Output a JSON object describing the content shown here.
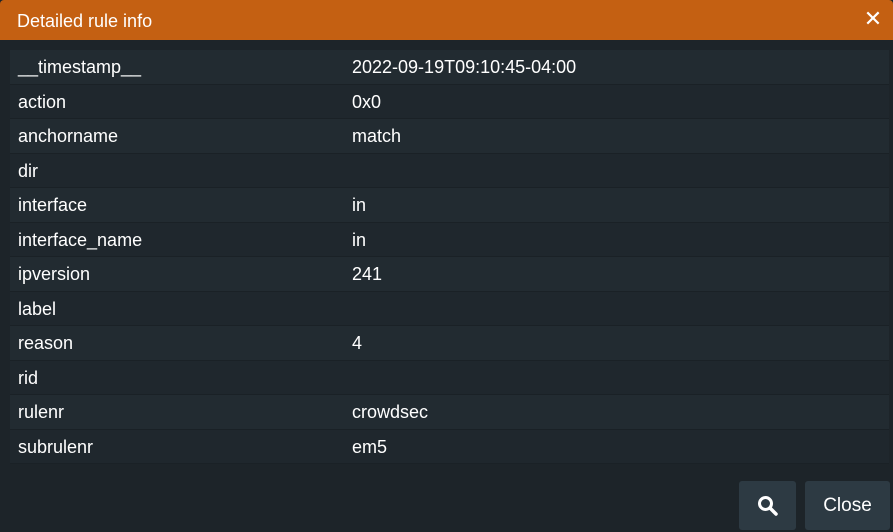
{
  "dialog": {
    "title": "Detailed rule info",
    "close_glyph": "✕"
  },
  "rows": [
    {
      "key": "__timestamp__",
      "value": "2022-09-19T09:10:45-04:00"
    },
    {
      "key": "action",
      "value": "0x0"
    },
    {
      "key": "anchorname",
      "value": "match"
    },
    {
      "key": "dir",
      "value": ""
    },
    {
      "key": "interface",
      "value": "in"
    },
    {
      "key": "interface_name",
      "value": "in"
    },
    {
      "key": "ipversion",
      "value": "241"
    },
    {
      "key": "label",
      "value": ""
    },
    {
      "key": "reason",
      "value": "4"
    },
    {
      "key": "rid",
      "value": ""
    },
    {
      "key": "rulenr",
      "value": "crowdsec"
    },
    {
      "key": "subrulenr",
      "value": "em5"
    }
  ],
  "footer": {
    "search_icon": "search-icon",
    "close_label": "Close"
  },
  "colors": {
    "titlebar": "#c46012",
    "background": "#1d2429",
    "row": "#222b31",
    "button": "#2d3a43"
  }
}
